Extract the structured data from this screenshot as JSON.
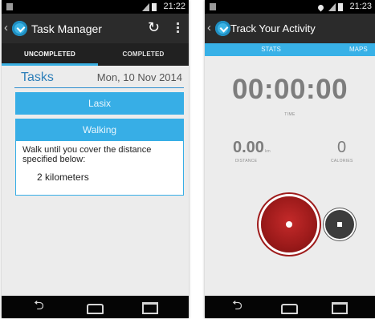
{
  "left_screen": {
    "status_time": "21:22",
    "app_title": "Task Manager",
    "tabs": [
      {
        "label": "UNCOMPLETED",
        "active": true
      },
      {
        "label": "COMPLETED",
        "active": false
      }
    ],
    "header": {
      "title": "Tasks",
      "date": "Mon, 10 Nov 2014"
    },
    "tasks": [
      {
        "label": "Lasix"
      },
      {
        "label": "Walking",
        "detail": "Walk until you cover the distance specified below:",
        "distance": "2 kilometers"
      }
    ]
  },
  "right_screen": {
    "status_time": "21:23",
    "app_title": "Track Your Activity",
    "tabs": [
      {
        "label": "STATS",
        "active": true
      },
      {
        "label": "MAPS",
        "active": false
      }
    ],
    "timer": {
      "value": "00:00:00",
      "label": "TIME"
    },
    "distance": {
      "value": "0.00",
      "unit": "km",
      "label": "DISTANCE"
    },
    "calories": {
      "value": "0",
      "label": "CALORIES"
    }
  },
  "colors": {
    "accent": "#37aee6",
    "actionbar": "#2b2b2b",
    "record": "#9e1b1b"
  },
  "icons": {
    "back": "chevron-left-icon",
    "logo": "app-logo-icon",
    "refresh": "refresh-icon",
    "overflow": "overflow-menu-icon",
    "record": "record-icon",
    "stop": "stop-icon"
  }
}
